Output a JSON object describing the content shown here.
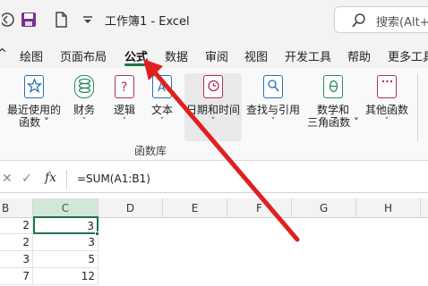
{
  "title_bar": {
    "title": "工作簿1 - Excel",
    "search_placeholder": "搜索(Alt+",
    "icons": [
      "restore-icon",
      "save-icon",
      "new-file-icon",
      "customize-qat-icon",
      "search-icon"
    ]
  },
  "menu": {
    "tabs": [
      {
        "label": "^"
      },
      {
        "label": "绘图"
      },
      {
        "label": "页面布局"
      },
      {
        "label": "公式",
        "active": true
      },
      {
        "label": "数据"
      },
      {
        "label": "审阅"
      },
      {
        "label": "视图"
      },
      {
        "label": "开发工具"
      },
      {
        "label": "帮助"
      },
      {
        "label": "更多工具"
      }
    ]
  },
  "ribbon": {
    "group_label": "函数库",
    "buttons": [
      {
        "line1": "最近使用的",
        "line2": "函数 ˅",
        "icon": "star-icon"
      },
      {
        "line1": "财务",
        "line2": "˅",
        "icon": "coins-icon"
      },
      {
        "line1": "逻辑",
        "line2": "˅",
        "icon": "question-book-icon"
      },
      {
        "line1": "文本",
        "line2": "˅",
        "icon": "text-book-icon"
      },
      {
        "line1": "日期和时间",
        "line2": "˅",
        "icon": "clock-book-icon"
      },
      {
        "line1": "查找与引用",
        "line2": "˅",
        "icon": "magnifier-book-icon"
      },
      {
        "line1": "数学和",
        "line2": "三角函数 ˅",
        "icon": "theta-book-icon"
      },
      {
        "line1": "其他函数",
        "line2": "˅",
        "icon": "more-book-icon"
      }
    ]
  },
  "formula_bar": {
    "cancel": "✕",
    "enter": "✓",
    "fx": "fx",
    "formula": "=SUM(A1:B1)"
  },
  "grid": {
    "columns": [
      "B",
      "C",
      "D",
      "E",
      "F",
      "G",
      "H"
    ],
    "selected_column": "C",
    "rows": [
      {
        "B": "2",
        "C": "3"
      },
      {
        "B": "2",
        "C": "3"
      },
      {
        "B": "3",
        "C": "5"
      },
      {
        "B": "7",
        "C": "12"
      }
    ]
  },
  "colors": {
    "accent": "#217346",
    "arrow": "#e02020"
  }
}
